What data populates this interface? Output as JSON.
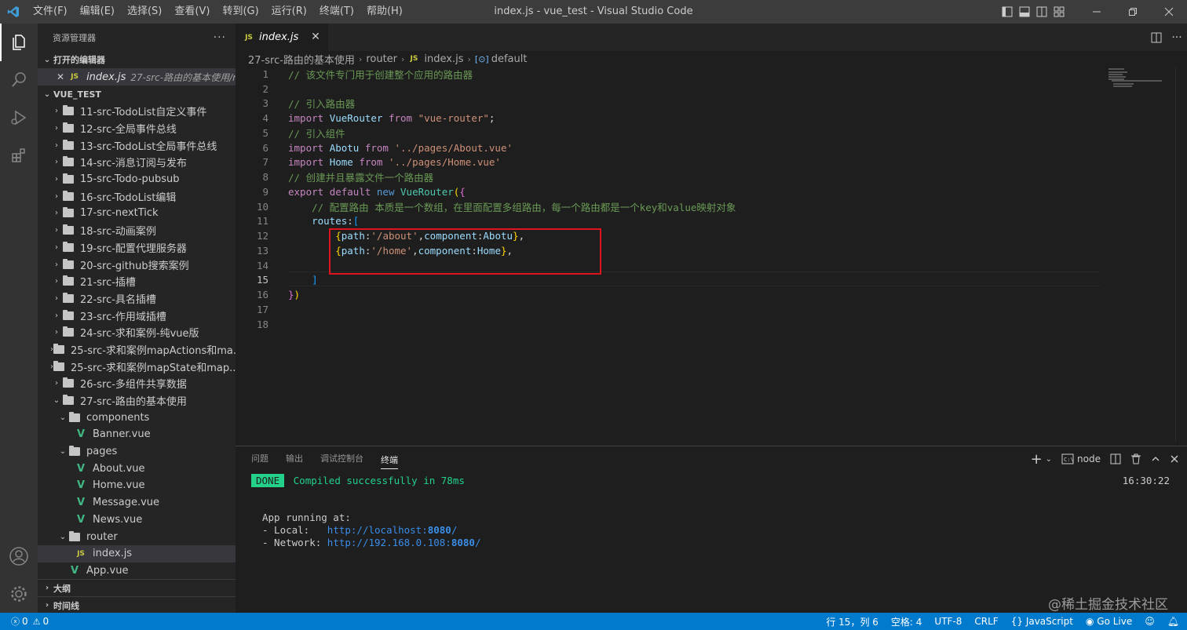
{
  "titlebar": {
    "menu": [
      "文件(F)",
      "编辑(E)",
      "选择(S)",
      "查看(V)",
      "转到(G)",
      "运行(R)",
      "终端(T)",
      "帮助(H)"
    ],
    "title": "index.js - vue_test - Visual Studio Code"
  },
  "sidebar": {
    "header": "资源管理器",
    "more": "···",
    "open_editors_title": "打开的编辑器",
    "open_editor": {
      "name": "index.js",
      "path": "27-src-路由的基本使用/ro..."
    },
    "project_title": "VUE_TEST",
    "folders": [
      "11-src-TodoList自定义事件",
      "12-src-全局事件总线",
      "13-src-TodoList全局事件总线",
      "14-src-消息订阅与发布",
      "15-src-Todo-pubsub",
      "16-src-TodoList编辑",
      "17-src-nextTick",
      "18-src-动画案例",
      "19-src-配置代理服务器",
      "20-src-github搜索案例",
      "21-src-插槽",
      "22-src-具名插槽",
      "23-src-作用域插槽",
      "24-src-求和案例-纯vue版",
      "25-src-求和案例mapActions和ma...",
      "25-src-求和案例mapState和map...",
      "26-src-多组件共享数据",
      "27-src-路由的基本使用"
    ],
    "sub": {
      "components": "components",
      "banner": "Banner.vue",
      "pages": "pages",
      "about": "About.vue",
      "home": "Home.vue",
      "message": "Message.vue",
      "news": "News.vue",
      "router": "router",
      "index": "index.js",
      "app": "App.vue"
    },
    "outline": "大纲",
    "timeline": "时间线"
  },
  "editor": {
    "tab": "index.js",
    "breadcrumb": [
      "27-src-路由的基本使用",
      "router",
      "index.js",
      "default"
    ],
    "line_numbers": [
      "1",
      "2",
      "3",
      "4",
      "5",
      "6",
      "7",
      "8",
      "9",
      "10",
      "11",
      "12",
      "13",
      "14",
      "15",
      "16",
      "17",
      "18"
    ],
    "current_line": 15
  },
  "panel": {
    "tabs": [
      "问题",
      "输出",
      "调试控制台",
      "终端"
    ],
    "active_tab": "终端",
    "shell": "node",
    "done": "DONE",
    "compiled": "Compiled successfully in 78ms",
    "time": "16:30:22",
    "running": "App running at:",
    "local_label": "- Local:   ",
    "local_url": "http://localhost:",
    "local_port": "8080",
    "network_label": "- Network: ",
    "network_url": "http://192.168.0.108:",
    "network_port": "8080",
    "slash": "/"
  },
  "statusbar": {
    "errors": "0",
    "warnings": "0",
    "position": "行 15，列 6",
    "spaces": "空格: 4",
    "encoding": "UTF-8",
    "eol": "CRLF",
    "language": "JavaScript",
    "golive": "Go Live"
  },
  "watermark": "@稀土掘金技术社区",
  "colors": {
    "statusbar": "#007acc",
    "highlight_box": "#e0141e",
    "done_badge": "#23d18b"
  }
}
